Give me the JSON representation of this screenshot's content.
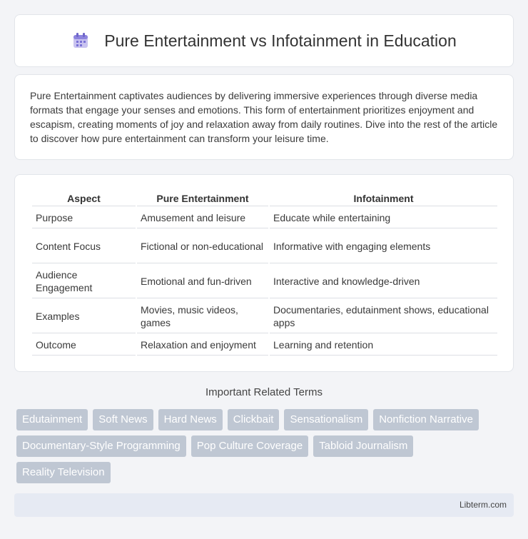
{
  "header": {
    "title": "Pure Entertainment vs Infotainment in Education",
    "icon": "calendar-icon"
  },
  "intro": {
    "text": "Pure Entertainment captivates audiences by delivering immersive experiences through diverse media formats that engage your senses and emotions. This form of entertainment prioritizes enjoyment and escapism, creating moments of joy and relaxation away from daily routines. Dive into the rest of the article to discover how pure entertainment can transform your leisure time."
  },
  "table": {
    "headers": [
      "Aspect",
      "Pure Entertainment",
      "Infotainment"
    ],
    "rows": [
      [
        "Purpose",
        "Amusement and leisure",
        "Educate while entertaining"
      ],
      [
        "Content Focus",
        "Fictional or non-educational",
        "Informative with engaging elements"
      ],
      [
        "Audience Engagement",
        "Emotional and fun-driven",
        "Interactive and knowledge-driven"
      ],
      [
        "Examples",
        "Movies, music videos, games",
        "Documentaries, edutainment shows, educational apps"
      ],
      [
        "Outcome",
        "Relaxation and enjoyment",
        "Learning and retention"
      ]
    ]
  },
  "related": {
    "title": "Important Related Terms",
    "tags": [
      "Edutainment",
      "Soft News",
      "Hard News",
      "Clickbait",
      "Sensationalism",
      "Nonfiction Narrative",
      "Documentary-Style Programming",
      "Pop Culture Coverage",
      "Tabloid Journalism",
      "Reality Television"
    ]
  },
  "footer": {
    "text": "Libterm.com"
  }
}
